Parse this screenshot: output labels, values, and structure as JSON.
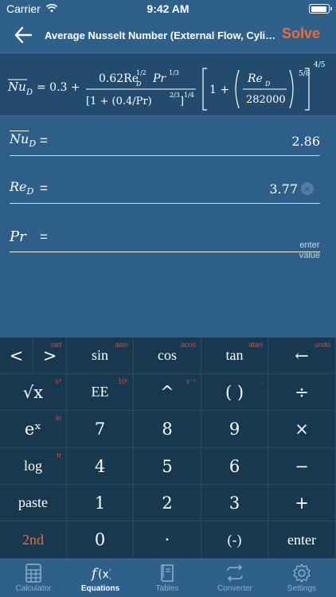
{
  "status": {
    "carrier": "Carrier",
    "time": "9:42 AM",
    "battery_level": 0.95
  },
  "nav": {
    "title": "Average Nusselt Number (External Flow, Cylind...",
    "solve_label": "Solve"
  },
  "formula": {
    "lhs": "Nu",
    "lhs_sub": "D",
    "eq_const": "= 0.3 +",
    "num": "0.62Re",
    "num_exp": "1/2",
    "num_sub": "D",
    "num_pr": "Pr",
    "num_pr_exp": "1/3",
    "den": "[1 + (0.4/Pr)",
    "den_exp": "2/3",
    "den_close": "]",
    "den_outer_exp": "1/4",
    "br_one": "1 +",
    "re": "Re",
    "re_sub": "D",
    "re_den": "282000",
    "inner_exp": "5/8",
    "outer_exp": "4/5"
  },
  "fields": [
    {
      "label": "Nu",
      "sub": "D",
      "eq": "=",
      "value": "2.86"
    },
    {
      "label": "Re",
      "sub": "D",
      "eq": "=",
      "value": "3.77"
    },
    {
      "label": "Pr",
      "sub": "",
      "eq": "=",
      "value": ""
    }
  ],
  "hint": {
    "line1": "enter",
    "line2": "value"
  },
  "keypad": {
    "rows": [
      [
        {
          "label": "<",
          "sup": ""
        },
        {
          "label": ">",
          "sup": "rad"
        },
        {
          "label": "sin",
          "sup": "asin"
        },
        {
          "label": "cos",
          "sup": "acos"
        },
        {
          "label": "tan",
          "sup": "atan"
        },
        {
          "label": "←",
          "sup": "undo"
        }
      ],
      [
        {
          "label": "√x",
          "sup": "x²"
        },
        {
          "label": "EE",
          "sup": "10ˣ"
        },
        {
          "label": "^",
          "sup": "x⁻¹"
        },
        {
          "label": "( )",
          "sup": ","
        },
        {
          "label": "÷",
          "sup": ""
        }
      ],
      [
        {
          "label": "eˣ",
          "sup": "ln"
        },
        {
          "label": "7",
          "sup": ""
        },
        {
          "label": "8",
          "sup": ""
        },
        {
          "label": "9",
          "sup": ""
        },
        {
          "label": "×",
          "sup": ""
        }
      ],
      [
        {
          "label": "log",
          "sup": "π"
        },
        {
          "label": "4",
          "sup": ""
        },
        {
          "label": "5",
          "sup": ""
        },
        {
          "label": "6",
          "sup": ""
        },
        {
          "label": "−",
          "sup": ""
        }
      ],
      [
        {
          "label": "paste",
          "sup": ""
        },
        {
          "label": "1",
          "sup": ""
        },
        {
          "label": "2",
          "sup": ""
        },
        {
          "label": "3",
          "sup": ""
        },
        {
          "label": "+",
          "sup": ""
        }
      ],
      [
        {
          "label": "2nd",
          "sup": ""
        },
        {
          "label": "0",
          "sup": ""
        },
        {
          "label": "·",
          "sup": ""
        },
        {
          "label": "(-)",
          "sup": ""
        },
        {
          "label": "enter",
          "sup": ""
        }
      ]
    ]
  },
  "tabs": [
    {
      "label": "Calculator",
      "icon": "calculator-icon"
    },
    {
      "label": "Equations",
      "icon": "function-icon"
    },
    {
      "label": "Tables",
      "icon": "book-icon"
    },
    {
      "label": "Converter",
      "icon": "arrows-icon"
    },
    {
      "label": "Settings",
      "icon": "gear-icon"
    }
  ],
  "colors": {
    "accent": "#f06a3c",
    "background": "#2e5f88",
    "keypad": "#17384f"
  }
}
